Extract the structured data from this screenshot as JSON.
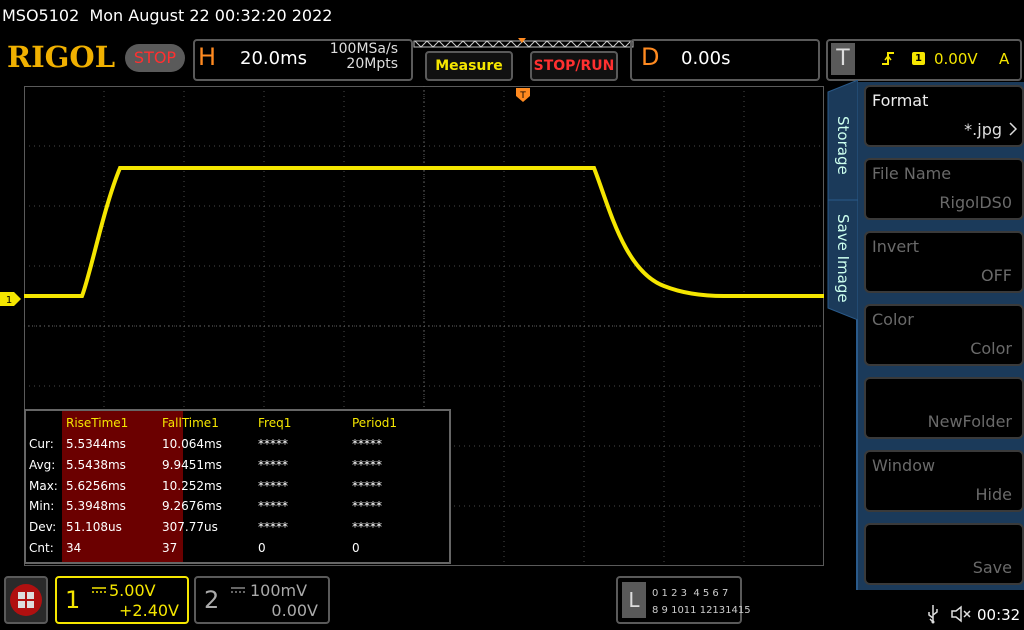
{
  "status": {
    "model": "MSO5102",
    "datetime": "Mon August 22 00:32:20 2022"
  },
  "header": {
    "logo": "RIGOL",
    "stop_label": "STOP",
    "h_letter": "H",
    "timebase": "20.0ms",
    "sample_rate": "100MSa/s",
    "memory_depth": "20Mpts",
    "measure_label": "Measure",
    "stoprun_label": "STOP/RUN",
    "d_letter": "D",
    "delay": "0.00s",
    "t_letter": "T",
    "trigger_channel": "1",
    "trigger_level": "0.00V",
    "trigger_mode": "A"
  },
  "measurements": {
    "columns": [
      "RiseTime1",
      "FallTime1",
      "Freq1",
      "Period1"
    ],
    "rows": [
      {
        "label": "Cur:",
        "values": [
          "5.5344ms",
          "10.064ms",
          "*****",
          "*****"
        ]
      },
      {
        "label": "Avg:",
        "values": [
          "5.5438ms",
          "9.9451ms",
          "*****",
          "*****"
        ]
      },
      {
        "label": "Max:",
        "values": [
          "5.6256ms",
          "10.252ms",
          "*****",
          "*****"
        ]
      },
      {
        "label": "Min:",
        "values": [
          "5.3948ms",
          "9.2676ms",
          "*****",
          "*****"
        ]
      },
      {
        "label": "Dev:",
        "values": [
          "51.108us",
          "307.77us",
          "*****",
          "*****"
        ]
      },
      {
        "label": "Cnt:",
        "values": [
          "34",
          "37",
          "0",
          "0"
        ]
      }
    ]
  },
  "side_panel": {
    "tabs": [
      "Storage",
      "Save Image"
    ],
    "items": [
      {
        "title": "Format",
        "value": "*.jpg",
        "enabled": true
      },
      {
        "title": "File Name",
        "value": "RigolDS0",
        "enabled": false
      },
      {
        "title": "Invert",
        "value": "OFF",
        "enabled": false
      },
      {
        "title": "Color",
        "value": "Color",
        "enabled": false
      },
      {
        "title": "",
        "value": "NewFolder",
        "enabled": false
      },
      {
        "title": "Window",
        "value": "Hide",
        "enabled": false
      },
      {
        "title": "",
        "value": "Save",
        "enabled": false
      }
    ]
  },
  "channels": {
    "ch1": {
      "number": "1",
      "scale": "5.00V",
      "offset": "+2.40V",
      "color": "#f5e600"
    },
    "ch2": {
      "number": "2",
      "scale": "100mV",
      "offset": "0.00V",
      "color": "#888888"
    }
  },
  "digital": {
    "letter": "L",
    "row1": "0 1 2 3  4 5 6 7",
    "row2": "8 9 1011 12131415"
  },
  "clock": "00:32",
  "ch1_marker": "1",
  "colors": {
    "trace": "#f5e600",
    "accent": "#ff8a20",
    "grid": "#5a5a5a",
    "panel": "#1b3a5a"
  }
}
